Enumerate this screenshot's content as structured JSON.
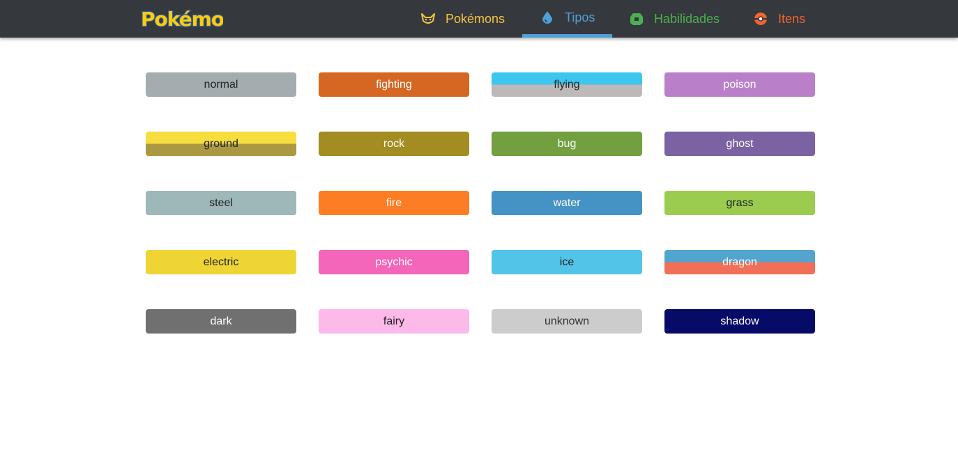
{
  "header": {
    "logo_text": "Pokémon",
    "nav": [
      {
        "label": "Pokémons",
        "color": "#f5c542",
        "icon": "pikachu-icon"
      },
      {
        "label": "Tipos",
        "color": "#4fa0d6",
        "icon": "water-drop-icon",
        "active": true
      },
      {
        "label": "Habilidades",
        "color": "#4caf50",
        "icon": "gem-icon"
      },
      {
        "label": "Itens",
        "color": "#f26430",
        "icon": "pokeball-icon"
      }
    ]
  },
  "types": [
    {
      "name": "normal",
      "colors": [
        "#a4acaf"
      ],
      "text_color": "#222222"
    },
    {
      "name": "fighting",
      "colors": [
        "#d56723"
      ],
      "text_color": "#ffffff"
    },
    {
      "name": "flying",
      "colors": [
        "#3dc7ef",
        "#bdb9b8"
      ],
      "text_color": "#222222"
    },
    {
      "name": "poison",
      "colors": [
        "#b97fc9"
      ],
      "text_color": "#ffffff"
    },
    {
      "name": "ground",
      "colors": [
        "#f7de3f",
        "#ab9842"
      ],
      "text_color": "#222222"
    },
    {
      "name": "rock",
      "colors": [
        "#a38c21"
      ],
      "text_color": "#ffffff"
    },
    {
      "name": "bug",
      "colors": [
        "#729f3f"
      ],
      "text_color": "#ffffff"
    },
    {
      "name": "ghost",
      "colors": [
        "#7b62a3"
      ],
      "text_color": "#ffffff"
    },
    {
      "name": "steel",
      "colors": [
        "#9eb7b8"
      ],
      "text_color": "#222222"
    },
    {
      "name": "fire",
      "colors": [
        "#fd7d24"
      ],
      "text_color": "#ffffff"
    },
    {
      "name": "water",
      "colors": [
        "#4592c4"
      ],
      "text_color": "#ffffff"
    },
    {
      "name": "grass",
      "colors": [
        "#9bcc50"
      ],
      "text_color": "#222222"
    },
    {
      "name": "electric",
      "colors": [
        "#eed535"
      ],
      "text_color": "#222222"
    },
    {
      "name": "psychic",
      "colors": [
        "#f366b9"
      ],
      "text_color": "#ffffff"
    },
    {
      "name": "ice",
      "colors": [
        "#51c4e7"
      ],
      "text_color": "#222222"
    },
    {
      "name": "dragon",
      "colors": [
        "#53a4cf",
        "#f16e57"
      ],
      "text_color": "#ffffff"
    },
    {
      "name": "dark",
      "colors": [
        "#707070"
      ],
      "text_color": "#ffffff"
    },
    {
      "name": "fairy",
      "colors": [
        "#fdb9e9"
      ],
      "text_color": "#222222"
    },
    {
      "name": "unknown",
      "colors": [
        "#cccccc"
      ],
      "text_color": "#333333"
    },
    {
      "name": "shadow",
      "colors": [
        "#070b68"
      ],
      "text_color": "#ffffff"
    }
  ]
}
